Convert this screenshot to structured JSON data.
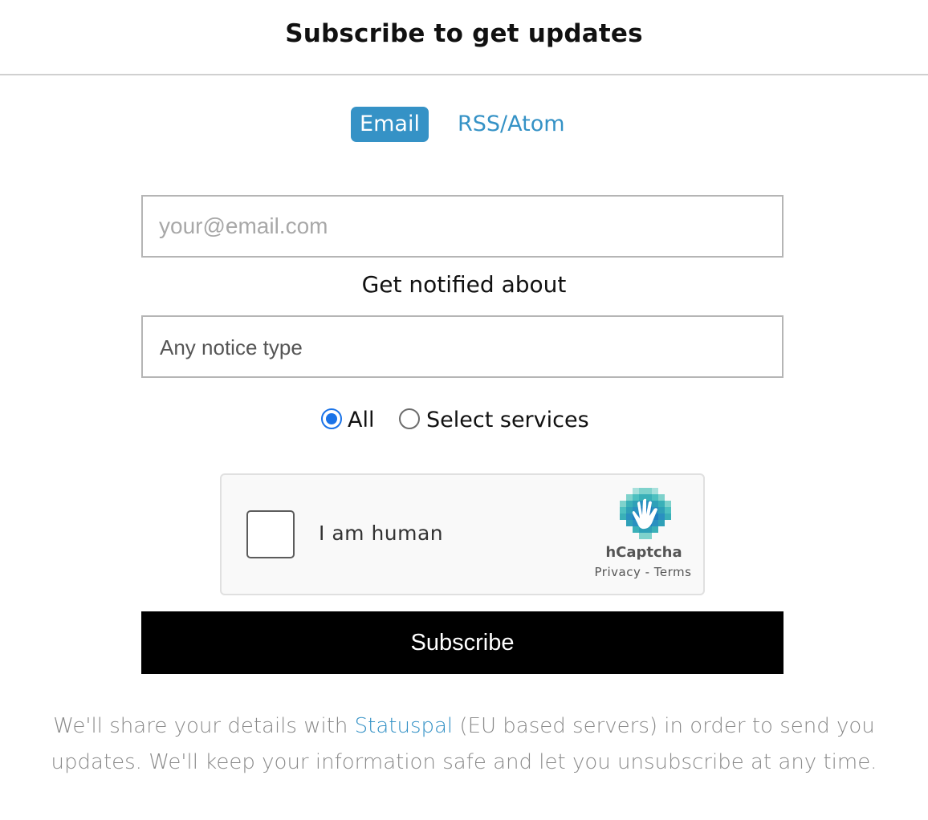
{
  "header": {
    "title": "Subscribe to get updates"
  },
  "tabs": [
    {
      "label": "Email",
      "active": true
    },
    {
      "label": "RSS/Atom",
      "active": false
    }
  ],
  "form": {
    "email_placeholder": "your@email.com",
    "email_value": "",
    "notify_label": "Get notified about",
    "notice_type_selected": "Any notice type",
    "radio_all_label": "All",
    "radio_select_label": "Select services",
    "radio_selected": "All",
    "subscribe_label": "Subscribe"
  },
  "captcha": {
    "prompt": "I am human",
    "brand": "hCaptcha",
    "privacy_label": "Privacy",
    "separator": " - ",
    "terms_label": "Terms",
    "checked": false
  },
  "footer": {
    "text_before": "We'll share your details with ",
    "link_label": "Statuspal",
    "text_after": " (EU based servers) in order to send you updates. We'll keep your information safe and let you unsubscribe at any time."
  },
  "colors": {
    "accent": "#3592c6",
    "radio_checked": "#1a73e8",
    "button_bg": "#000000",
    "captcha_logo_teal": "#4dc0c0",
    "captcha_logo_blue": "#1f6fb5"
  }
}
